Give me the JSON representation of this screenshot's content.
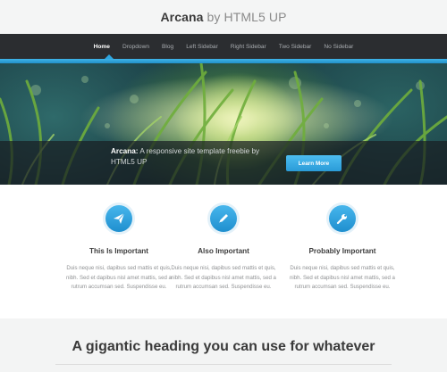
{
  "header": {
    "brand_strong": "Arcana",
    "brand_light": "by HTML5 UP"
  },
  "nav": {
    "items": [
      {
        "label": "Home",
        "active": true
      },
      {
        "label": "Dropdown"
      },
      {
        "label": "Blog"
      },
      {
        "label": "Left Sidebar"
      },
      {
        "label": "Right Sidebar"
      },
      {
        "label": "Two Sidebar"
      },
      {
        "label": "No Sidebar"
      }
    ],
    "accent_color": "#2ea6e0"
  },
  "banner": {
    "caption_strong": "Arcana:",
    "caption_text": "A responsive site template freebie by HTML5 UP",
    "button_label": "Learn More"
  },
  "features": [
    {
      "icon": "paper-plane-icon",
      "title": "This Is Important",
      "text": "Duis neque nisi, dapibus sed mattis et quis, nibh. Sed et dapibus nisl amet mattis, sed a rutrum accumsan sed. Suspendisse eu."
    },
    {
      "icon": "pencil-icon",
      "title": "Also Important",
      "text": "Duis neque nisi, dapibus sed mattis et quis, nibh. Sed et dapibus nisl amet mattis, sed a rutrum accumsan sed. Suspendisse eu."
    },
    {
      "icon": "wrench-icon",
      "title": "Probably Important",
      "text": "Duis neque nisi, dapibus sed mattis et quis, nibh. Sed et dapibus nisl amet mattis, sed a rutrum accumsan sed. Suspendisse eu."
    }
  ],
  "main": {
    "heading": "A gigantic heading you can use for whatever"
  }
}
